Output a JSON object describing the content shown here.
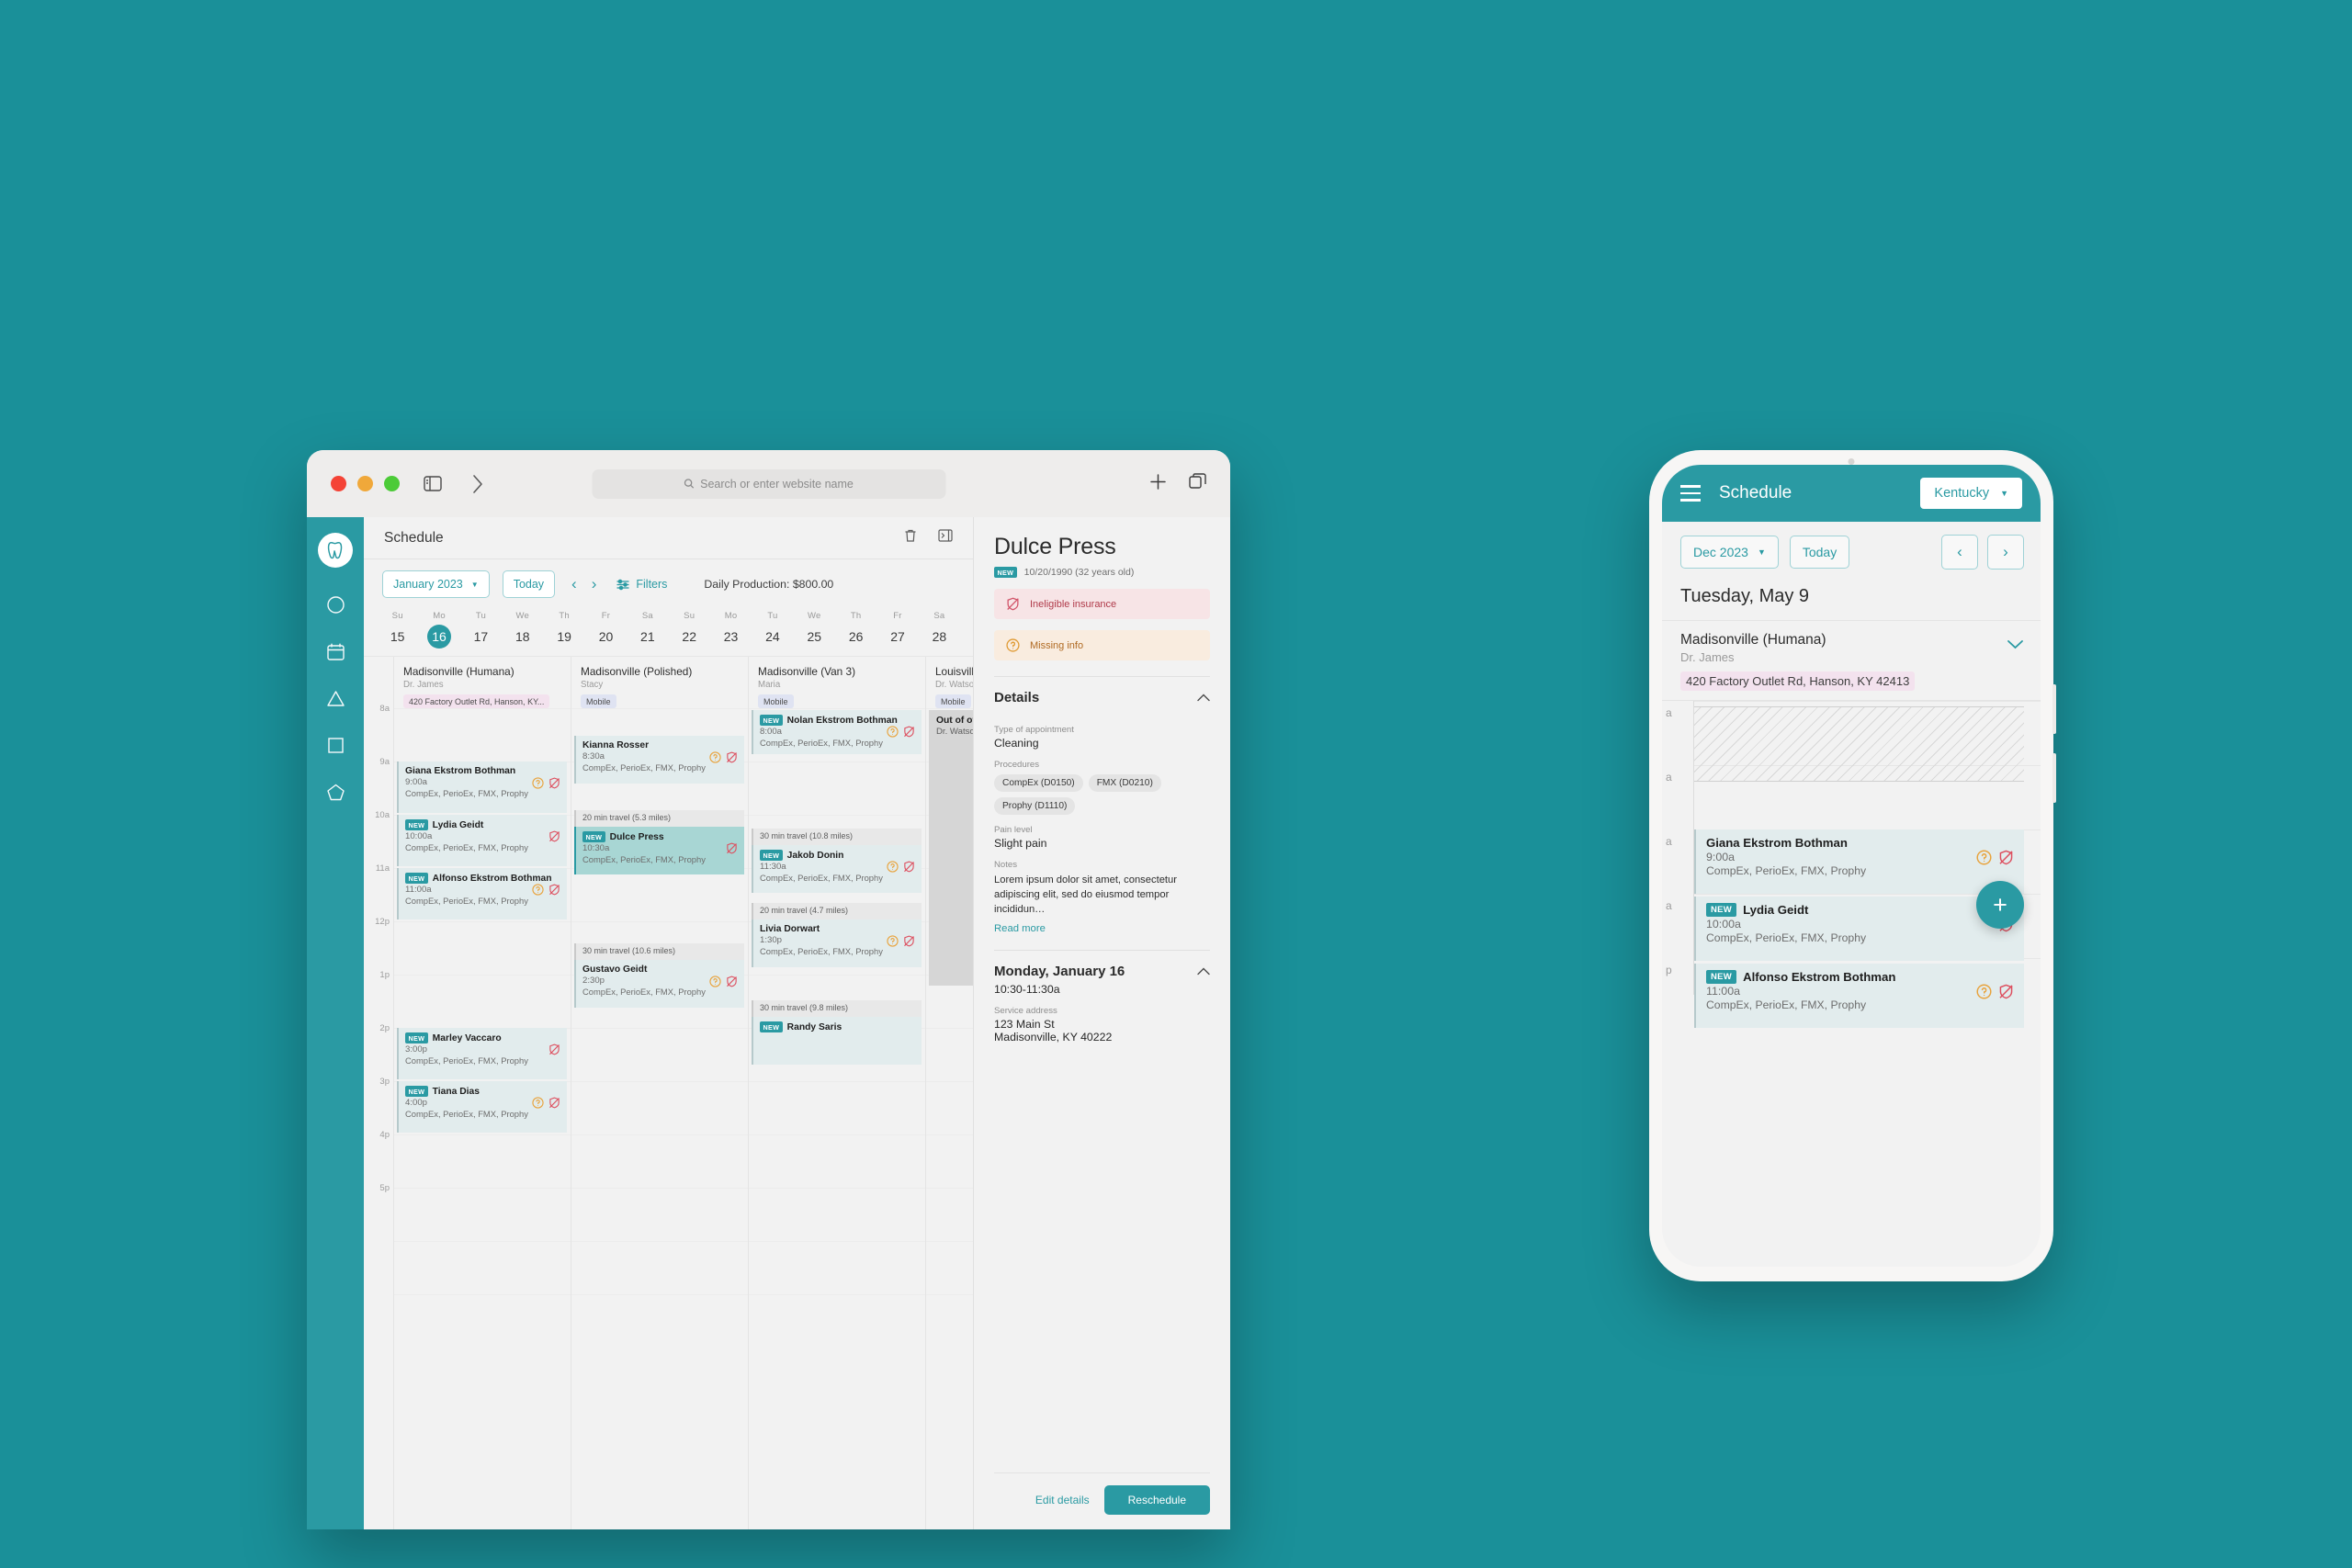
{
  "browser": {
    "search_placeholder": "Search or enter website name",
    "icons": [
      "sidebar-toggle-icon",
      "back-icon",
      "forward-icon",
      "new-tab-icon",
      "tab-overview-icon"
    ]
  },
  "app": {
    "page_title": "Schedule",
    "rail_icons": [
      "app-logo",
      "circle-icon",
      "calendar-icon",
      "triangle-icon",
      "square-icon",
      "pentagon-icon"
    ],
    "header_icons": [
      "trash-icon",
      "collapse-panel-icon"
    ]
  },
  "toolbar": {
    "month_label": "January 2023",
    "today_label": "Today",
    "prev_label": "‹",
    "next_label": "›",
    "filters_label": "Filters",
    "daily_production_label": "Daily Production:",
    "daily_production_value": "$800.00"
  },
  "datestrip": [
    {
      "dow": "Su",
      "num": "15",
      "selected": false
    },
    {
      "dow": "Mo",
      "num": "16",
      "selected": true
    },
    {
      "dow": "Tu",
      "num": "17",
      "selected": false
    },
    {
      "dow": "We",
      "num": "18",
      "selected": false
    },
    {
      "dow": "Th",
      "num": "19",
      "selected": false
    },
    {
      "dow": "Fr",
      "num": "20",
      "selected": false
    },
    {
      "dow": "Sa",
      "num": "21",
      "selected": false
    },
    {
      "dow": "Su",
      "num": "22",
      "selected": false
    },
    {
      "dow": "Mo",
      "num": "23",
      "selected": false
    },
    {
      "dow": "Tu",
      "num": "24",
      "selected": false
    },
    {
      "dow": "We",
      "num": "25",
      "selected": false
    },
    {
      "dow": "Th",
      "num": "26",
      "selected": false
    },
    {
      "dow": "Fr",
      "num": "27",
      "selected": false
    },
    {
      "dow": "Sa",
      "num": "28",
      "selected": false
    }
  ],
  "hours": [
    "8a",
    "9a",
    "10a",
    "11a",
    "12p",
    "1p",
    "2p",
    "3p",
    "4p",
    "5p"
  ],
  "columns": [
    {
      "name": "Madisonville (Humana)",
      "provider": "Dr. James",
      "tag": "420 Factory Outlet Rd, Hanson, KY...",
      "tag_type": "address"
    },
    {
      "name": "Madisonville (Polished)",
      "provider": "Stacy",
      "tag": "Mobile",
      "tag_type": "mobile"
    },
    {
      "name": "Madisonville (Van 3)",
      "provider": "Maria",
      "tag": "Mobile",
      "tag_type": "mobile"
    },
    {
      "name": "Louisville (Kare)",
      "provider": "Dr. Watson",
      "tag": "Mobile",
      "tag_type": "mobile"
    }
  ],
  "appointments": {
    "col1": [
      {
        "name": "Giana Ekstrom Bothman",
        "time": "9:00a",
        "procedures": "CompEx, PerioEx, FMX, Prophy",
        "new": false,
        "warn": true,
        "shield": true
      },
      {
        "name": "Lydia Geidt",
        "time": "10:00a",
        "procedures": "CompEx, PerioEx, FMX, Prophy",
        "new": true,
        "warn": false,
        "shield": true
      },
      {
        "name": "Alfonso Ekstrom Bothman",
        "time": "11:00a",
        "procedures": "CompEx, PerioEx, FMX, Prophy",
        "new": true,
        "warn": true,
        "shield": true
      },
      {
        "name": "Marley Vaccaro",
        "time": "3:00p",
        "procedures": "CompEx, PerioEx, FMX, Prophy",
        "new": true,
        "warn": false,
        "shield": true
      },
      {
        "name": "Tiana Dias",
        "time": "4:00p",
        "procedures": "CompEx, PerioEx, FMX, Prophy",
        "new": true,
        "warn": true,
        "shield": true
      }
    ],
    "col2": [
      {
        "name": "Kianna Rosser",
        "time": "8:30a",
        "procedures": "CompEx, PerioEx, FMX, Prophy",
        "new": false,
        "warn": true,
        "shield": true
      },
      {
        "name": "Dulce Press",
        "time": "10:30a",
        "procedures": "CompEx, PerioEx, FMX, Prophy",
        "new": true,
        "warn": false,
        "shield": true,
        "selected": true
      },
      {
        "name": "Gustavo Geidt",
        "time": "2:30p",
        "procedures": "CompEx, PerioEx, FMX, Prophy",
        "new": false,
        "warn": true,
        "shield": true
      }
    ],
    "col3": [
      {
        "name": "Nolan Ekstrom Bothman",
        "time": "8:00a",
        "procedures": "CompEx, PerioEx, FMX, Prophy",
        "new": true,
        "warn": true,
        "shield": true
      },
      {
        "name": "Jakob Donin",
        "time": "11:30a",
        "procedures": "CompEx, PerioEx, FMX, Prophy",
        "new": true,
        "warn": true,
        "shield": true
      },
      {
        "name": "Livia Dorwart",
        "time": "1:30p",
        "procedures": "CompEx, PerioEx, FMX, Prophy",
        "new": false,
        "warn": true,
        "shield": true
      },
      {
        "name": "Randy Saris",
        "time": "",
        "procedures": "",
        "new": true,
        "warn": false,
        "shield": false
      }
    ]
  },
  "travel": {
    "c2_a": "20 min travel (5.3 miles)",
    "c2_b": "30 min travel (10.6 miles)",
    "c3_a": "30 min travel (10.8 miles)",
    "c3_b": "20 min travel (4.7 miles)",
    "c3_c": "30 min travel (9.8 miles)"
  },
  "out_of_office": {
    "title": "Out of office",
    "text": "Dr. Watson is out of o"
  },
  "detail": {
    "patient_name": "Dulce Press",
    "new_badge": "NEW",
    "dob": "10/20/1990 (32 years old)",
    "alerts": [
      {
        "label": "Ineligible insurance",
        "icon": "shield-off-icon",
        "type": "red"
      },
      {
        "label": "Missing info",
        "icon": "question-circle-icon",
        "type": "amber"
      }
    ],
    "details_heading": "Details",
    "type_label": "Type of appointment",
    "type_value": "Cleaning",
    "procedures_label": "Procedures",
    "procedures": [
      "CompEx (D0150)",
      "FMX (D0210)",
      "Prophy (D1110)"
    ],
    "pain_label": "Pain level",
    "pain_value": "Slight pain",
    "notes_label": "Notes",
    "notes_value": "Lorem ipsum dolor sit amet, consectetur adipiscing elit, sed do eiusmod tempor incididun…",
    "read_more": "Read more",
    "date_heading": "Monday, January 16",
    "time_range": "10:30-11:30a",
    "address_label": "Service address",
    "address_line1": "123 Main St",
    "address_line2": "Madisonville, KY 40222",
    "edit_label": "Edit details",
    "reschedule_label": "Reschedule"
  },
  "mobile": {
    "title": "Schedule",
    "state": "Kentucky",
    "month_label": "Dec 2023",
    "today_label": "Today",
    "prev_label": "‹",
    "next_label": "›",
    "date_heading": "Tuesday, May 9",
    "op_name": "Madisonville (Humana)",
    "op_provider": "Dr. James",
    "op_address": "420 Factory Outlet Rd, Hanson, KY 42413",
    "hours": [
      "a",
      "a",
      "a",
      "a",
      "p"
    ],
    "appointments": [
      {
        "name": "Giana Ekstrom Bothman",
        "time": "9:00a",
        "procedures": "CompEx, PerioEx, FMX, Prophy",
        "new": false,
        "warn": true,
        "shield": true
      },
      {
        "name": "Lydia Geidt",
        "time": "10:00a",
        "procedures": "CompEx, PerioEx, FMX, Prophy",
        "new": true,
        "warn": false,
        "shield": true
      },
      {
        "name": "Alfonso Ekstrom Bothman",
        "time": "11:00a",
        "procedures": "CompEx, PerioEx, FMX, Prophy",
        "new": true,
        "warn": true,
        "shield": true
      }
    ],
    "fab_label": "+"
  },
  "colors": {
    "accent": "#2a9aa3",
    "background": "#1a9099",
    "alert_red": "#b03a4a",
    "alert_amber": "#b06a22",
    "appt_bg": "#e2eced",
    "appt_selected_bg": "#a8d6d4"
  }
}
